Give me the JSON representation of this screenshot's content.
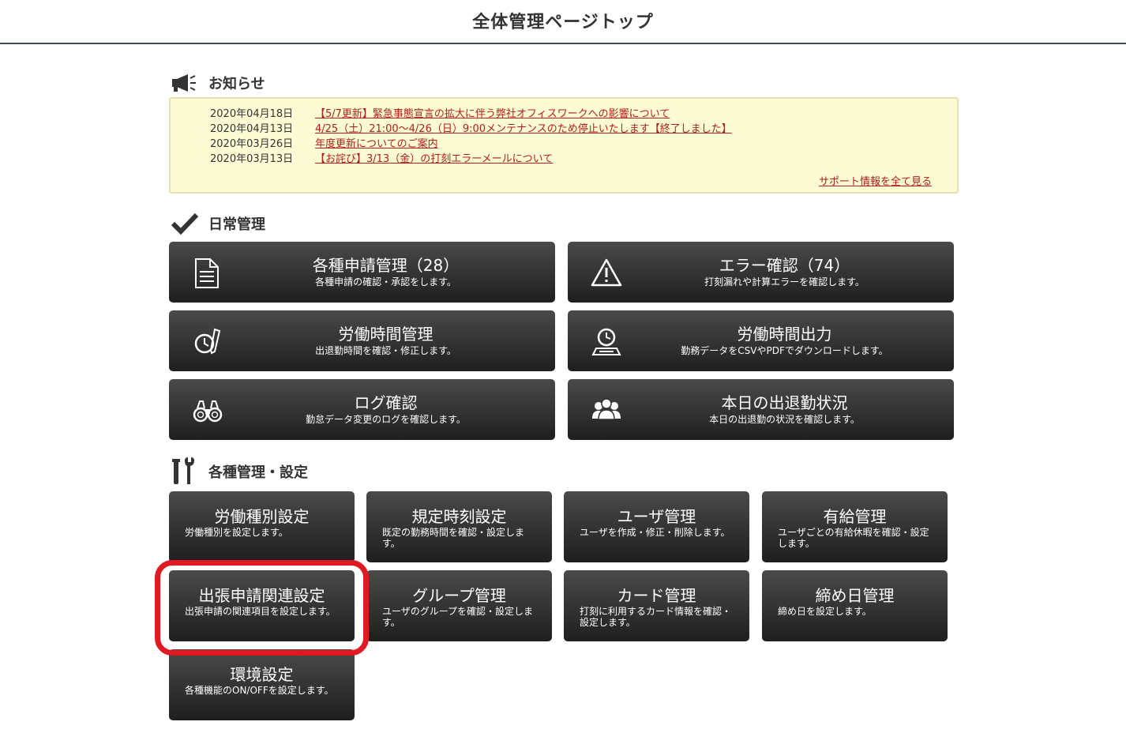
{
  "header": {
    "title": "全体管理ページトップ"
  },
  "notices": {
    "heading": "お知らせ",
    "items": [
      {
        "date": "2020年04月18日",
        "text": "【5/7更新】緊急事態宣言の拡大に伴う弊社オフィスワークへの影響について"
      },
      {
        "date": "2020年04月13日",
        "text": "4/25（土）21:00～4/26（日）9:00メンテナンスのため停止いたします【終了しました】"
      },
      {
        "date": "2020年03月26日",
        "text": "年度更新についてのご案内"
      },
      {
        "date": "2020年03月13日",
        "text": "【お詫び】3/13（金）の打刻エラーメールについて"
      }
    ],
    "more_link": "サポート情報を全て見る"
  },
  "daily": {
    "heading": "日常管理",
    "buttons": [
      {
        "title": "各種申請管理（28）",
        "desc": "各種申請の確認・承認をします。",
        "icon": "document-icon"
      },
      {
        "title": "エラー確認（74）",
        "desc": "打刻漏れや計算エラーを確認します。",
        "icon": "warning-icon"
      },
      {
        "title": "労働時間管理",
        "desc": "出退勤時間を確認・修正します。",
        "icon": "clock-pencil-icon"
      },
      {
        "title": "労働時間出力",
        "desc": "勤務データをCSVやPDFでダウンロードします。",
        "icon": "download-clock-icon"
      },
      {
        "title": "ログ確認",
        "desc": "勤怠データ変更のログを確認します。",
        "icon": "binoculars-icon"
      },
      {
        "title": "本日の出退勤状況",
        "desc": "本日の出退勤の状況を確認します。",
        "icon": "users-icon"
      }
    ]
  },
  "settings": {
    "heading": "各種管理・設定",
    "buttons": [
      {
        "title": "労働種別設定",
        "desc": "労働種別を設定します。"
      },
      {
        "title": "規定時刻設定",
        "desc": "既定の勤務時間を確認・設定します。"
      },
      {
        "title": "ユーザ管理",
        "desc": "ユーザを作成・修正・削除します。"
      },
      {
        "title": "有給管理",
        "desc": "ユーザごとの有給休暇を確認・設定します。"
      },
      {
        "title": "出張申請関連設定",
        "desc": "出張申請の関連項目を設定します。"
      },
      {
        "title": "グループ管理",
        "desc": "ユーザのグループを確認・設定します。"
      },
      {
        "title": "カード管理",
        "desc": "打刻に利用するカード情報を確認・設定します。"
      },
      {
        "title": "締め日管理",
        "desc": "締め日を設定します。"
      },
      {
        "title": "環境設定",
        "desc": "各種機能のON/OFFを設定します。"
      }
    ]
  },
  "colors": {
    "accent_red": "#e11922",
    "link_red": "#b21d1d",
    "notice_bg": "#fdfbd3",
    "button_dark": "#2a2a2a"
  }
}
